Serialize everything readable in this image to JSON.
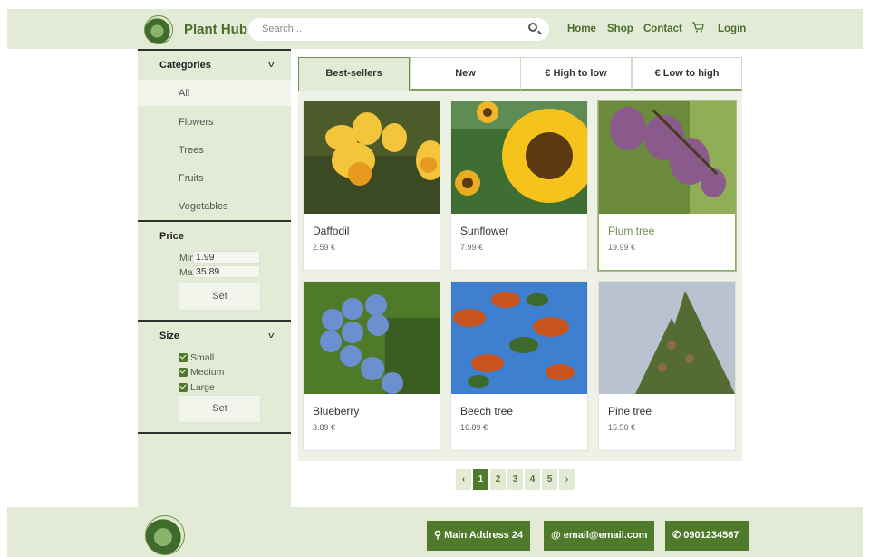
{
  "header": {
    "brand": "Plant Hub",
    "search_placeholder": "Search...",
    "nav": [
      "Home",
      "Shop",
      "Contact"
    ],
    "login": "Login"
  },
  "sidebar": {
    "categories": {
      "title": "Categories",
      "items": [
        "All",
        "Flowers",
        "Trees",
        "Fruits",
        "Vegetables"
      ]
    },
    "price": {
      "title": "Price",
      "min_label": "Min",
      "min_value": "1.99",
      "max_label": "Max",
      "max_value": "35.89",
      "set_label": "Set"
    },
    "size": {
      "title": "Size",
      "options": [
        "Small",
        "Medium",
        "Large"
      ],
      "set_label": "Set"
    }
  },
  "tabs": [
    "Best-sellers",
    "New",
    "€ High to low",
    "€ Low to high"
  ],
  "products": [
    {
      "name": "Daffodil",
      "price": "2.59 €"
    },
    {
      "name": "Sunflower",
      "price": "7.99 €"
    },
    {
      "name": "Plum tree",
      "price": "19.99 €"
    },
    {
      "name": "Blueberry",
      "price": "3.89 €"
    },
    {
      "name": "Beech tree",
      "price": "16.89 €"
    },
    {
      "name": "Pine tree",
      "price": "15.50 €"
    }
  ],
  "pagination": {
    "prev": "‹",
    "pages": [
      "1",
      "2",
      "3",
      "4",
      "5"
    ],
    "next": "›",
    "current": "1"
  },
  "footer": {
    "address": "Main Address 24",
    "email": "email@email.com",
    "phone": "0901234567"
  },
  "colors": {
    "accent": "#4f7a2c",
    "panel": "#e3ebd6",
    "brand_text": "#4b6f2b"
  }
}
